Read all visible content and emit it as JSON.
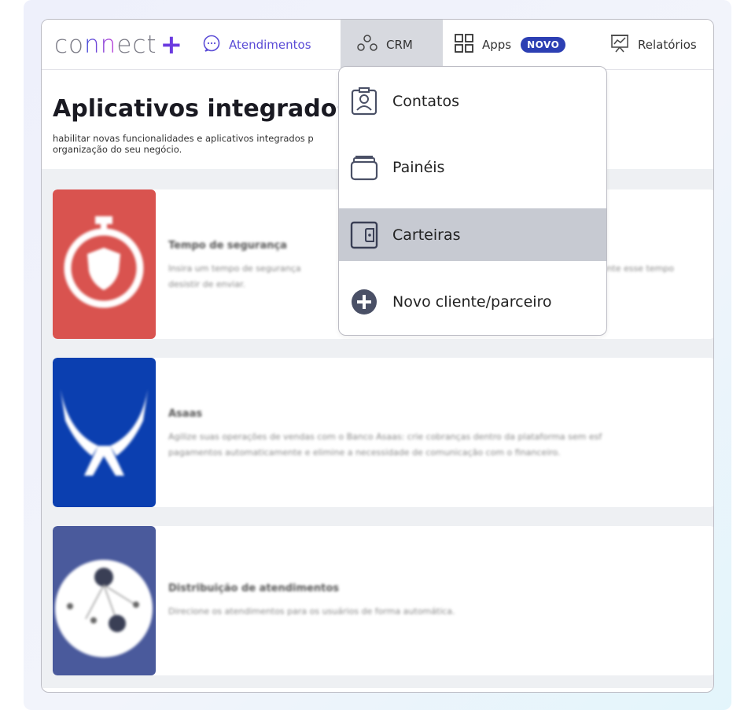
{
  "brand": {
    "logo_prefix": "co",
    "logo_nn": "nn",
    "logo_suffix": "ect",
    "logo_plus": "+"
  },
  "nav": {
    "atendimentos": "Atendimentos",
    "crm": "CRM",
    "apps": "Apps",
    "apps_badge": "NOVO",
    "relatorios": "Relatórios"
  },
  "page": {
    "title": "Aplicativos integrados",
    "description": "habilitar novas funcionalidades e aplicativos integrados p organização do seu negócio."
  },
  "apps": [
    {
      "title": "Tempo de segurança",
      "desc1": "Insira um tempo de segurança",
      "desc1b": "durante esse tempo",
      "desc2": "desistir de enviar.",
      "color": "#d9534f"
    },
    {
      "title": "Asaas",
      "desc1": "Agilize suas operações de vendas com o Banco Asaas: crie cobranças dentro da plataforma sem esf",
      "desc2": "pagamentos automaticamente e elimine a necessidade de comunicação com o financeiro.",
      "color": "#0b3fb0"
    },
    {
      "title": "Distribuição de atendimentos",
      "desc1": "Direcione os atendimentos para os usuários de forma automática.",
      "desc2": "",
      "color": "#4a5a9c"
    }
  ],
  "crm_menu": {
    "items": [
      {
        "label": "Contatos",
        "icon": "contact-card-icon"
      },
      {
        "label": "Painéis",
        "icon": "panels-icon"
      },
      {
        "label": "Carteiras",
        "icon": "wallet-icon",
        "active": true
      },
      {
        "label": "Novo cliente/parceiro",
        "icon": "add-circle-icon"
      }
    ]
  },
  "colors": {
    "accent": "#5a4bd6",
    "badge": "#2c3fb3",
    "crm_active_bg": "#d7d9df",
    "menu_active_bg": "#c7cad2"
  }
}
